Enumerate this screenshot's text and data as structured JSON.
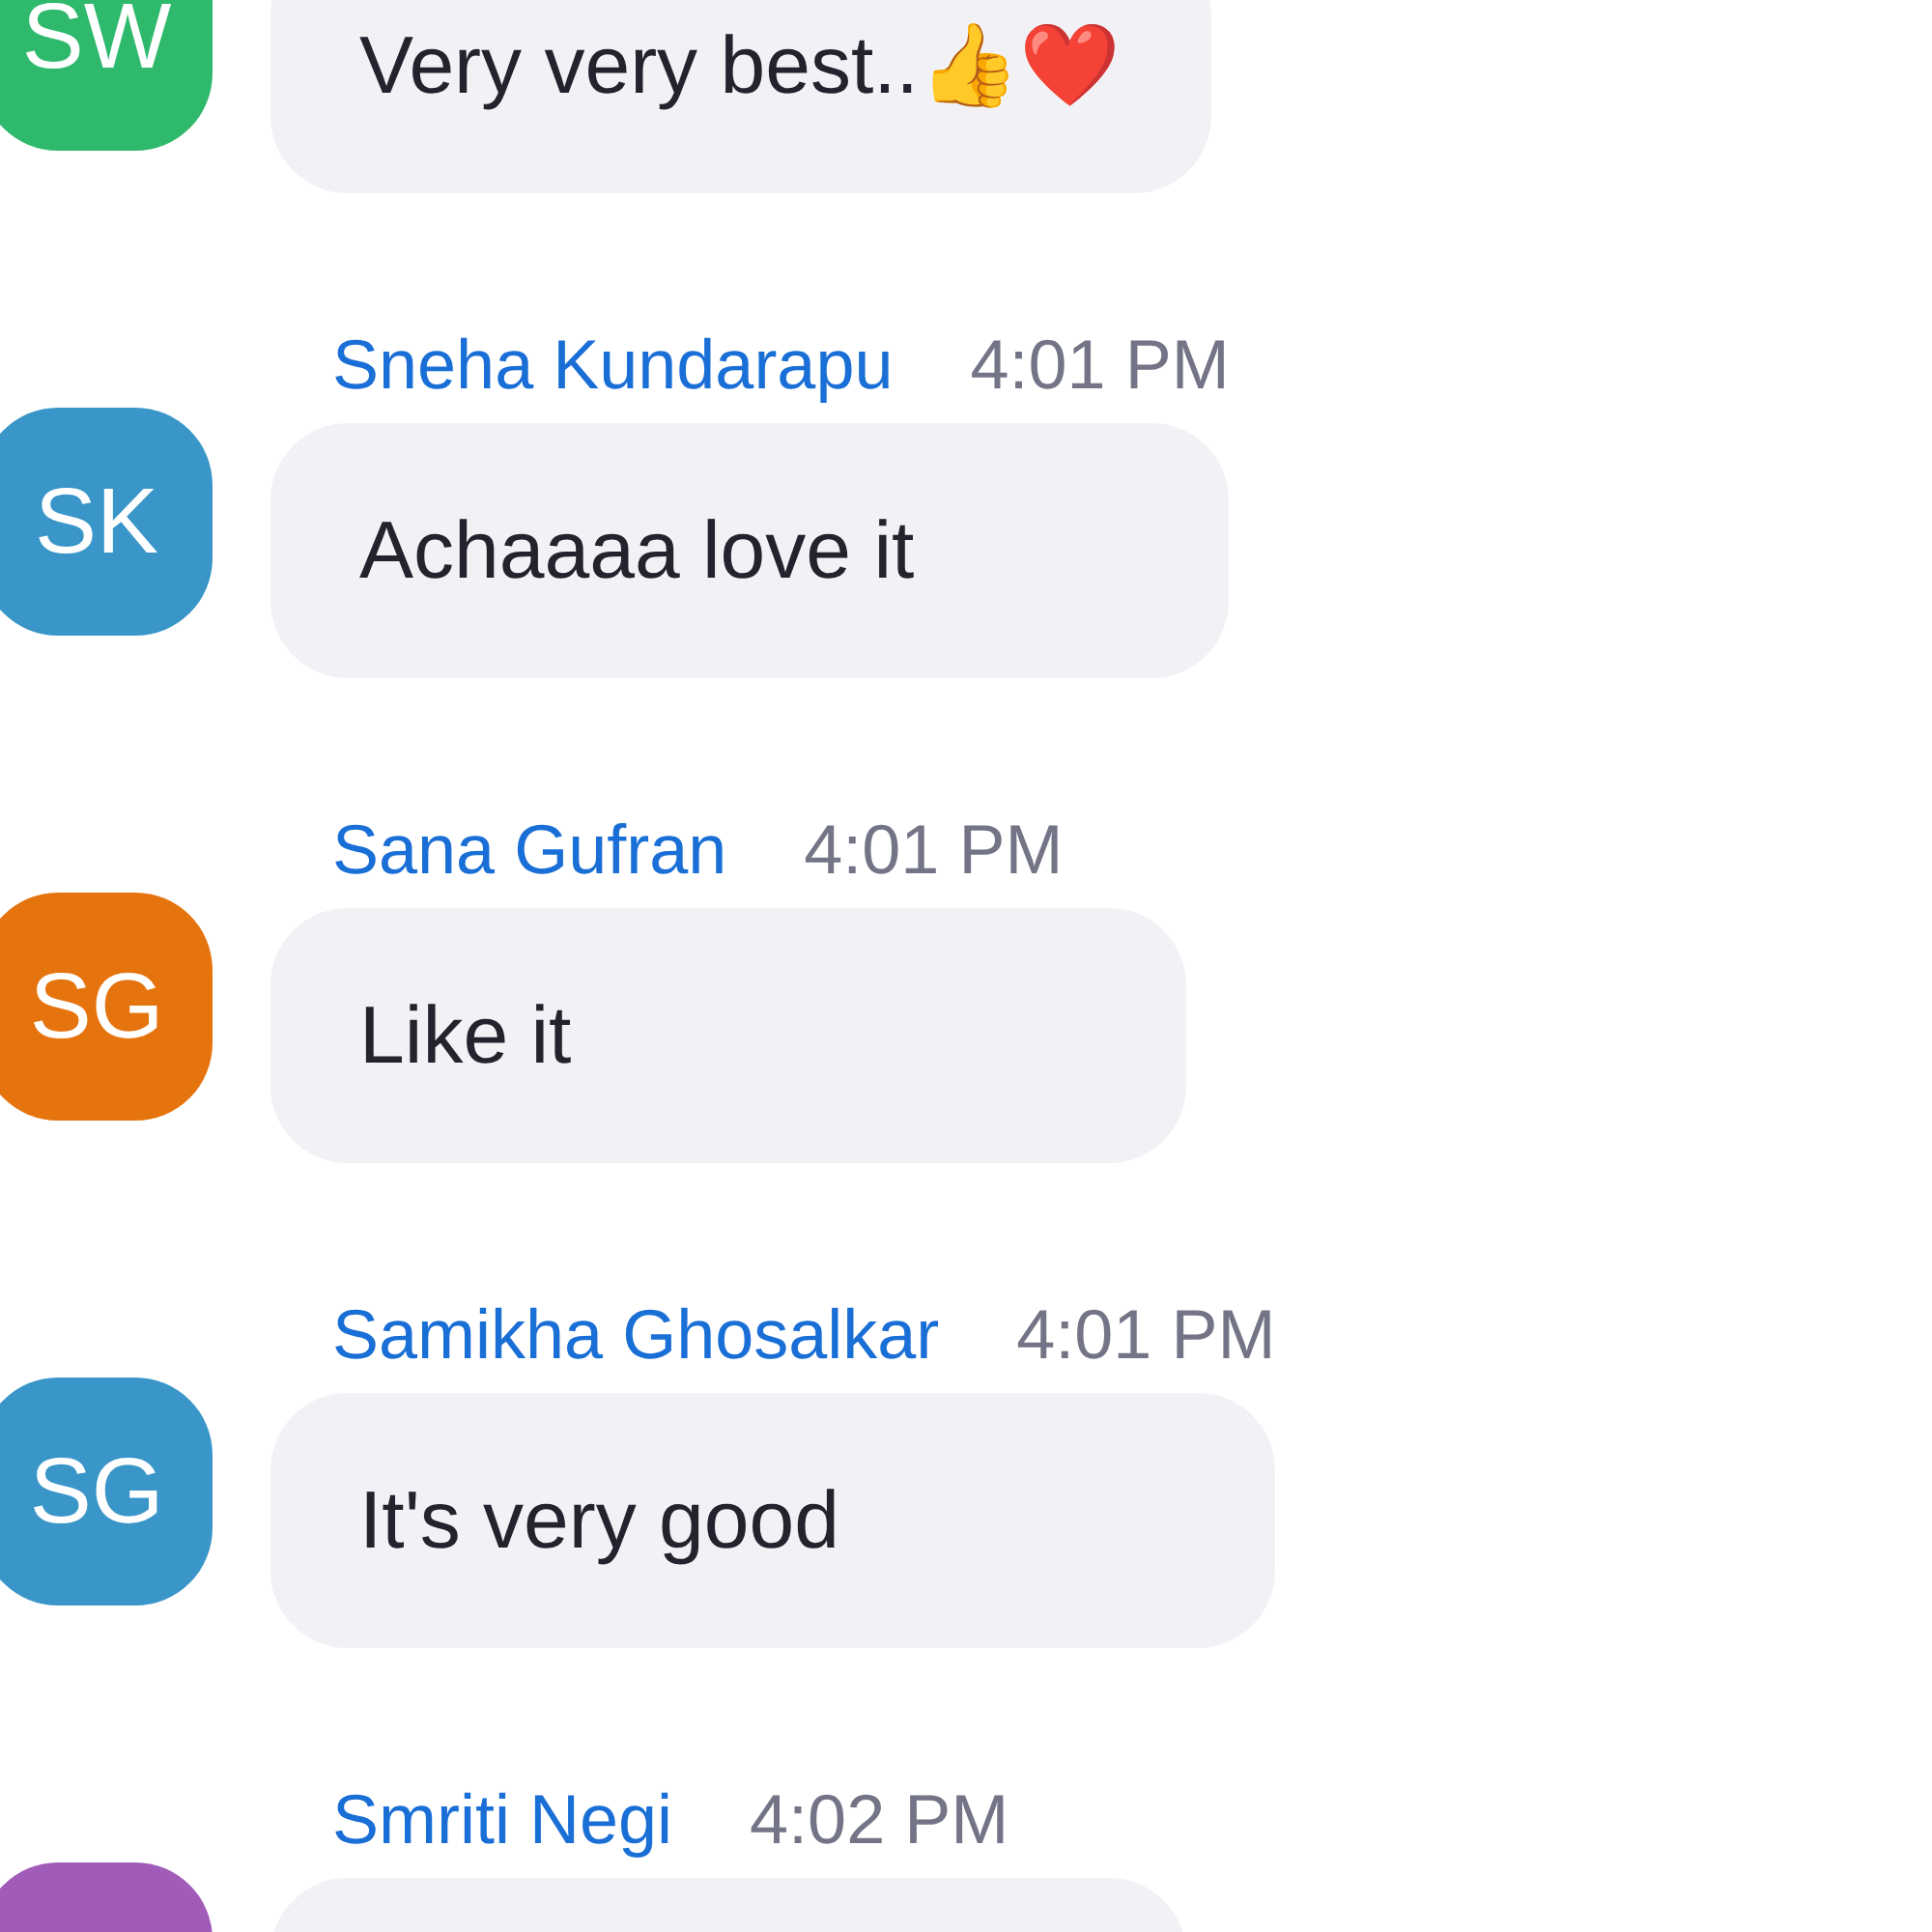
{
  "messages": [
    {
      "initials": "SW",
      "color": "#2fb96c",
      "text": "Very very best..👍❤️"
    },
    {
      "sender": "Sneha Kundarapu",
      "time": "4:01 PM",
      "initials": "SK",
      "color": "#3a96c8",
      "text": "Achaaaa love it"
    },
    {
      "sender": "Sana Gufran",
      "time": "4:01 PM",
      "initials": "SG",
      "color": "#e5740f",
      "text": "Like it"
    },
    {
      "sender": "Samikha Ghosalkar",
      "time": "4:01 PM",
      "initials": "SG",
      "color": "#3a96c8",
      "text": "It's very good"
    },
    {
      "sender": "Smriti Negi",
      "time": "4:02 PM",
      "color": "#a05cb8"
    }
  ]
}
